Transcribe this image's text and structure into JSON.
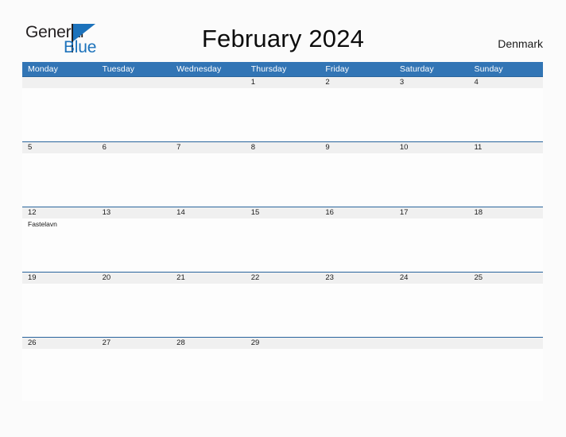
{
  "brand": {
    "name_part1": "General",
    "name_part2": "Blue",
    "flag_icon": "blue-triangle-flag-icon",
    "colors": {
      "text": "#231f20",
      "accent": "#1c72bb"
    }
  },
  "header": {
    "title": "February 2024",
    "country": "Denmark"
  },
  "theme": {
    "header_row_bg": "#3275b5",
    "header_row_text": "#ffffff",
    "date_strip_bg": "#f0f0f0",
    "week_divider": "#2a659d",
    "page_bg": "#fbfbfb",
    "cell_bg": "#fdfdfd",
    "text": "#1a1a1a"
  },
  "weekdays": [
    "Monday",
    "Tuesday",
    "Wednesday",
    "Thursday",
    "Friday",
    "Saturday",
    "Sunday"
  ],
  "weeks": [
    [
      {
        "day": "",
        "event": ""
      },
      {
        "day": "",
        "event": ""
      },
      {
        "day": "",
        "event": ""
      },
      {
        "day": "1",
        "event": ""
      },
      {
        "day": "2",
        "event": ""
      },
      {
        "day": "3",
        "event": ""
      },
      {
        "day": "4",
        "event": ""
      }
    ],
    [
      {
        "day": "5",
        "event": ""
      },
      {
        "day": "6",
        "event": ""
      },
      {
        "day": "7",
        "event": ""
      },
      {
        "day": "8",
        "event": ""
      },
      {
        "day": "9",
        "event": ""
      },
      {
        "day": "10",
        "event": ""
      },
      {
        "day": "11",
        "event": ""
      }
    ],
    [
      {
        "day": "12",
        "event": "Fastelavn"
      },
      {
        "day": "13",
        "event": ""
      },
      {
        "day": "14",
        "event": ""
      },
      {
        "day": "15",
        "event": ""
      },
      {
        "day": "16",
        "event": ""
      },
      {
        "day": "17",
        "event": ""
      },
      {
        "day": "18",
        "event": ""
      }
    ],
    [
      {
        "day": "19",
        "event": ""
      },
      {
        "day": "20",
        "event": ""
      },
      {
        "day": "21",
        "event": ""
      },
      {
        "day": "22",
        "event": ""
      },
      {
        "day": "23",
        "event": ""
      },
      {
        "day": "24",
        "event": ""
      },
      {
        "day": "25",
        "event": ""
      }
    ],
    [
      {
        "day": "26",
        "event": ""
      },
      {
        "day": "27",
        "event": ""
      },
      {
        "day": "28",
        "event": ""
      },
      {
        "day": "29",
        "event": ""
      },
      {
        "day": "",
        "event": ""
      },
      {
        "day": "",
        "event": ""
      },
      {
        "day": "",
        "event": ""
      }
    ]
  ]
}
